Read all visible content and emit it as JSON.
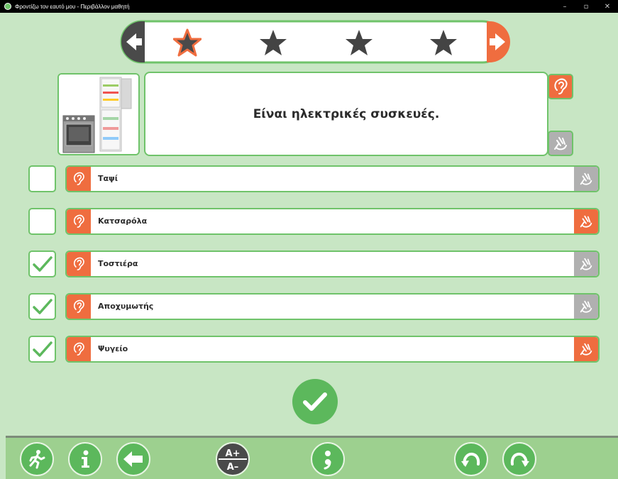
{
  "window": {
    "title": "Φροντίζω τον εαυτό μου - Περιβάλλον μαθητή",
    "minimize": "–",
    "maximize": "▫",
    "close": "✕"
  },
  "progress": {
    "stars_total": 4,
    "current_index": 0
  },
  "question": {
    "text": "Είναι ηλεκτρικές συσκευές.",
    "image": "kitchen-appliances"
  },
  "answers": [
    {
      "label": "Ταψί",
      "checked": false,
      "sign_color": "gray"
    },
    {
      "label": "Κατσαρόλα",
      "checked": false,
      "sign_color": "orange"
    },
    {
      "label": "Τοστιέρα",
      "checked": true,
      "sign_color": "gray"
    },
    {
      "label": "Αποχυμωτής",
      "checked": true,
      "sign_color": "gray"
    },
    {
      "label": "Ψυγείο",
      "checked": true,
      "sign_color": "orange"
    }
  ],
  "toolbar": {
    "font_size_plus": "A+",
    "font_size_minus": "A–",
    "icons": [
      "exit-icon",
      "info-icon",
      "back-icon",
      "font-size-icon",
      "semicolon-icon",
      "undo-icon",
      "redo-icon"
    ]
  },
  "colors": {
    "background": "#c8e6c4",
    "accent_green": "#6fc36a",
    "button_green": "#5cb85c",
    "orange": "#ef6d3f",
    "gray": "#b0b0b0",
    "star_dark": "#444444"
  }
}
